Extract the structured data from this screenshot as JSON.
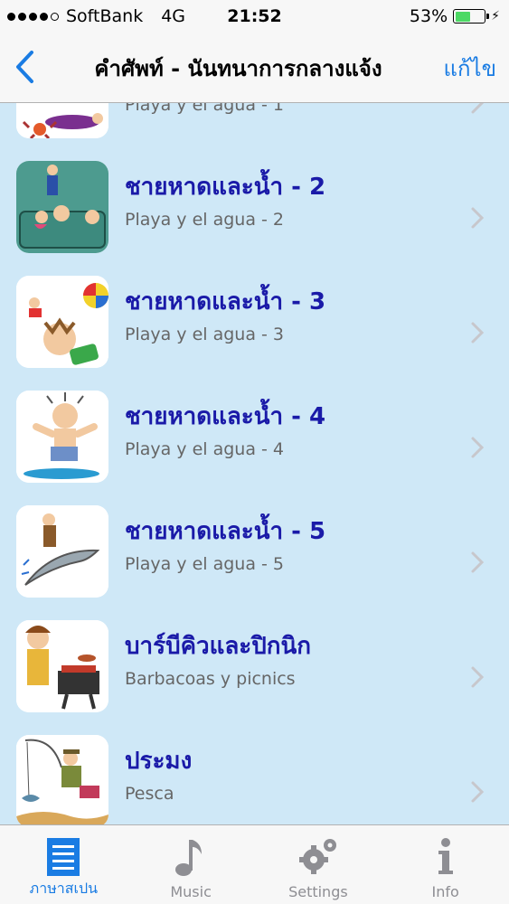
{
  "status_bar": {
    "carrier": "SoftBank",
    "network": "4G",
    "time": "21:52",
    "battery": "53%",
    "battery_level": 0.53
  },
  "nav": {
    "title": "คำศัพท์ - นันทนาการกลางแจ้ง",
    "back_icon": "chevron-left-icon",
    "edit_label": "แก้ไข"
  },
  "list": {
    "partial_item": {
      "subtitle": "Playa y el agua - 1"
    },
    "items": [
      {
        "title": "ชายหาดและน้ำ - 2",
        "subtitle": "Playa y el agua - 2",
        "icon": "beach-pool-illustration"
      },
      {
        "title": "ชายหาดและน้ำ - 3",
        "subtitle": "Playa y el agua - 3",
        "icon": "beach-ball-illustration"
      },
      {
        "title": "ชายหาดและน้ำ - 4",
        "subtitle": "Playa y el agua - 4",
        "icon": "surfer-illustration"
      },
      {
        "title": "ชายหาดและน้ำ - 5",
        "subtitle": "Playa y el agua - 5",
        "icon": "dolphin-illustration"
      },
      {
        "title": "บาร์บีคิวและปิกนิก",
        "subtitle": "Barbacoas y picnics",
        "icon": "barbecue-illustration"
      },
      {
        "title": "ประมง",
        "subtitle": "Pesca",
        "icon": "fishing-illustration"
      }
    ]
  },
  "tabs": [
    {
      "label": "ภาษาสเปน",
      "icon": "list-icon",
      "active": true
    },
    {
      "label": "Music",
      "icon": "music-note-icon",
      "active": false
    },
    {
      "label": "Settings",
      "icon": "gear-icon",
      "active": false
    },
    {
      "label": "Info",
      "icon": "info-icon",
      "active": false
    }
  ],
  "colors": {
    "accent": "#1a7ce3",
    "title_text": "#1a1aa8",
    "list_background": "#cfe8f7",
    "battery_fill": "#4cd964"
  }
}
